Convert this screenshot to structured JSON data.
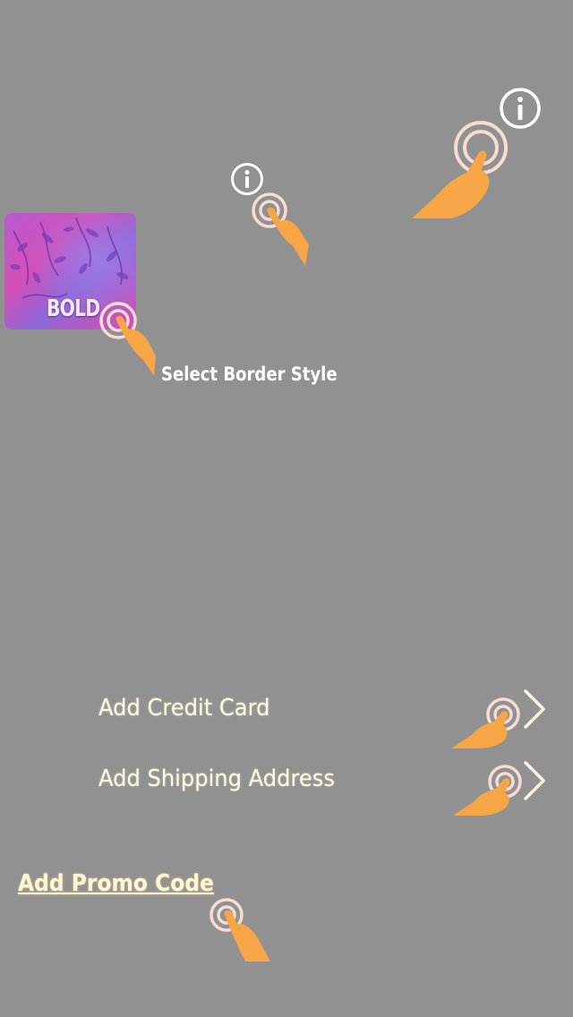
{
  "screen": {
    "background": "#919191"
  },
  "border_style": {
    "thumbnail_label": "BOLD",
    "hint": "Select Border Style"
  },
  "rows": {
    "credit_card": "Add Credit Card",
    "shipping_address": "Add Shipping Address"
  },
  "promo": {
    "label": "Add Promo Code"
  },
  "colors": {
    "hand": "#f6a647",
    "ring": "#f6dcd3",
    "thumb_pink": "#d63fb8",
    "thumb_purple": "#8a5bd6",
    "label_text": "#fffbe9"
  },
  "icons": [
    "info-icon",
    "info-icon",
    "tap-hand-icon",
    "chevron-right-icon"
  ]
}
